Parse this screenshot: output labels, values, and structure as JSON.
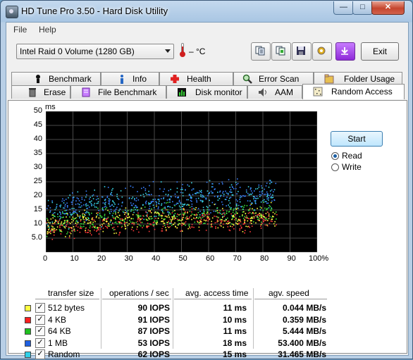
{
  "window": {
    "title": "HD Tune Pro 3.50 - Hard Disk Utility",
    "minimize_glyph": "—",
    "maximize_glyph": "□",
    "close_glyph": "✕"
  },
  "menu": {
    "file": "File",
    "help": "Help"
  },
  "toolbar": {
    "drive": "Intel   Raid 0 Volume (1280 GB)",
    "temperature": "– °C",
    "exit_label": "Exit",
    "icons": [
      "copy-text-icon",
      "copy-screenshot-icon",
      "save-icon",
      "options-icon",
      "download-icon"
    ]
  },
  "tabs_row1": [
    {
      "label": "Benchmark",
      "icon": "benchmark-icon"
    },
    {
      "label": "Info",
      "icon": "info-icon"
    },
    {
      "label": "Health",
      "icon": "health-cross-icon"
    },
    {
      "label": "Error Scan",
      "icon": "magnifier-icon"
    },
    {
      "label": "Folder Usage",
      "icon": "folder-usage-icon"
    }
  ],
  "tabs_row2": [
    {
      "label": "Erase",
      "icon": "trash-icon"
    },
    {
      "label": "File Benchmark",
      "icon": "file-benchmark-icon"
    },
    {
      "label": "Disk monitor",
      "icon": "disk-monitor-icon"
    },
    {
      "label": "AAM",
      "icon": "speaker-icon"
    },
    {
      "label": "Random Access",
      "icon": "random-access-icon",
      "active": true
    }
  ],
  "controls": {
    "start_label": "Start",
    "read_label": "Read",
    "write_label": "Write",
    "mode": "Read"
  },
  "chart_data": {
    "type": "scatter",
    "title": "",
    "ylabel": "ms",
    "xlabel": "",
    "ylim": [
      0,
      50
    ],
    "xlim": [
      0,
      100
    ],
    "y_ticks": [
      "50",
      "45",
      "40",
      "35",
      "30",
      "25",
      "20",
      "15",
      "10",
      "5.0"
    ],
    "x_ticks": [
      "0",
      "10",
      "20",
      "30",
      "40",
      "50",
      "60",
      "70",
      "80",
      "90",
      "100%"
    ],
    "grid": true,
    "series": [
      {
        "name": "512 bytes",
        "color": "#ffff40",
        "x_range": [
          0,
          85
        ],
        "y_center": [
          9,
          13
        ],
        "y_spread": 4
      },
      {
        "name": "4 KB",
        "color": "#ff3a3a",
        "x_range": [
          0,
          85
        ],
        "y_center": [
          8,
          12
        ],
        "y_spread": 4
      },
      {
        "name": "64 KB",
        "color": "#3ae03a",
        "x_range": [
          0,
          85
        ],
        "y_center": [
          9,
          14
        ],
        "y_spread": 4
      },
      {
        "name": "1 MB",
        "color": "#3a80ff",
        "x_range": [
          0,
          85
        ],
        "y_center": [
          14,
          21
        ],
        "y_spread": 5
      },
      {
        "name": "Random",
        "color": "#3ad8e8",
        "x_range": [
          0,
          85
        ],
        "y_center": [
          13,
          20
        ],
        "y_spread": 6
      }
    ]
  },
  "results": {
    "headers": [
      "transfer size",
      "operations / sec",
      "avg. access time",
      "agv. speed"
    ],
    "rows": [
      {
        "label": "512 bytes",
        "color": "#ffff40",
        "checked": "✓",
        "ops": "90 IOPS",
        "access": "11 ms",
        "speed": "0.044 MB/s"
      },
      {
        "label": "4 KB",
        "color": "#ff2020",
        "checked": "✓",
        "ops": "91 IOPS",
        "access": "10 ms",
        "speed": "0.359 MB/s"
      },
      {
        "label": "64 KB",
        "color": "#20c020",
        "checked": "✓",
        "ops": "87 IOPS",
        "access": "11 ms",
        "speed": "5.444 MB/s"
      },
      {
        "label": "1 MB",
        "color": "#2060e0",
        "checked": "✓",
        "ops": "53 IOPS",
        "access": "18 ms",
        "speed": "53.400 MB/s"
      },
      {
        "label": "Random",
        "color": "#30d0e8",
        "checked": "✓",
        "ops": "62 IOPS",
        "access": "15 ms",
        "speed": "31.465 MB/s"
      }
    ]
  }
}
